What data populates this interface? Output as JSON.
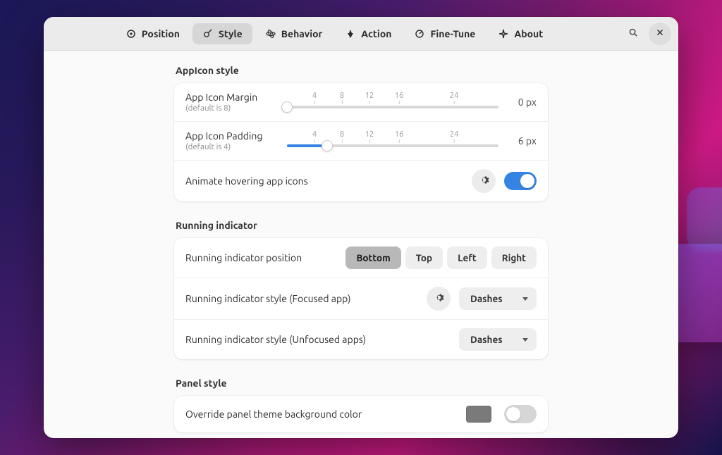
{
  "header": {
    "tabs": [
      {
        "id": "position",
        "label": "Position",
        "active": false
      },
      {
        "id": "style",
        "label": "Style",
        "active": true
      },
      {
        "id": "behavior",
        "label": "Behavior",
        "active": false
      },
      {
        "id": "action",
        "label": "Action",
        "active": false
      },
      {
        "id": "finetune",
        "label": "Fine-Tune",
        "active": false
      },
      {
        "id": "about",
        "label": "About",
        "active": false
      }
    ]
  },
  "groups": {
    "appicon": {
      "title": "AppIcon style",
      "margin": {
        "label": "App Icon Margin",
        "sub": "(default is 8)",
        "value_label": "0 px",
        "fill_pct": 0,
        "thumb_pct": 0
      },
      "padding": {
        "label": "App Icon Padding",
        "sub": "(default is 4)",
        "value_label": "6 px",
        "fill_pct": 19,
        "thumb_pct": 19
      },
      "ticks": [
        "4",
        "8",
        "12",
        "16",
        "24"
      ],
      "tick_positions_pct": [
        13,
        26,
        39,
        53,
        79
      ],
      "animate": {
        "label": "Animate hovering app icons",
        "value": true
      }
    },
    "running": {
      "title": "Running indicator",
      "position": {
        "label": "Running indicator position",
        "options": [
          "Bottom",
          "Top",
          "Left",
          "Right"
        ],
        "selected": "Bottom"
      },
      "focused": {
        "label": "Running indicator style (Focused app)",
        "value": "Dashes"
      },
      "unfocused": {
        "label": "Running indicator style (Unfocused apps)",
        "value": "Dashes"
      }
    },
    "panel": {
      "title": "Panel style",
      "override_bg": {
        "label": "Override panel theme background color",
        "value": false,
        "swatch": "#7a7a7a"
      }
    }
  }
}
